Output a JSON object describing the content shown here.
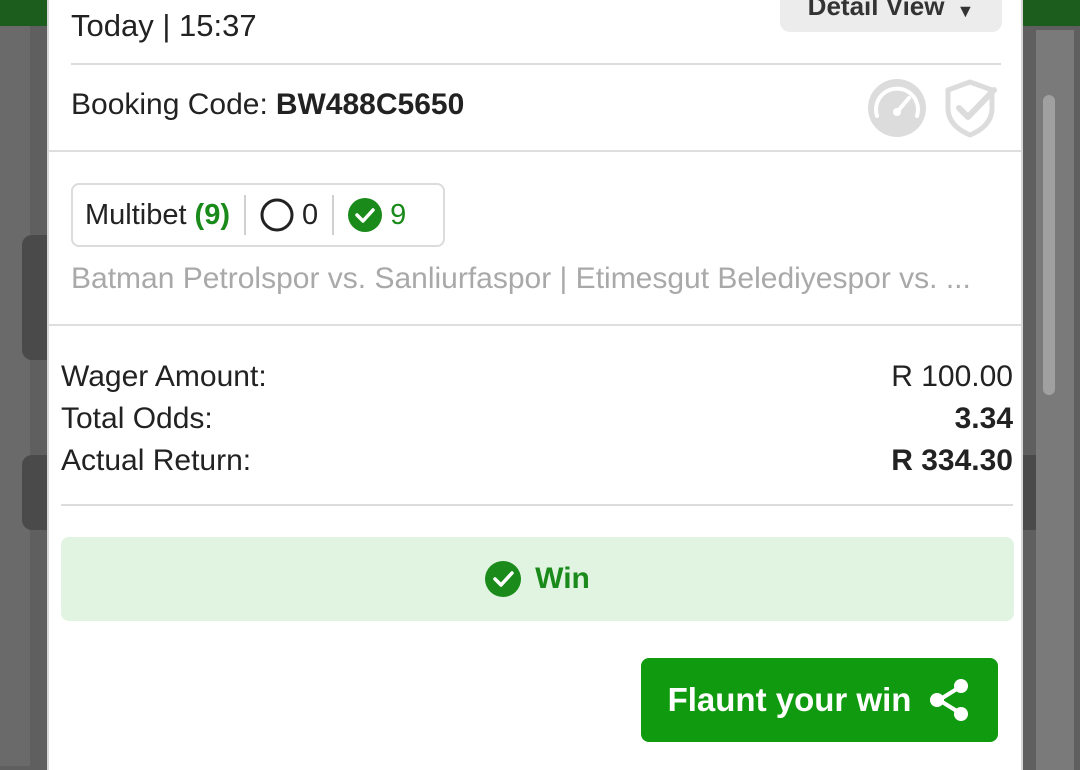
{
  "colors": {
    "accent_green": "#0f9a0f",
    "win_bg": "#e1f3e1",
    "muted_text": "#a9a9a9"
  },
  "header": {
    "date_time": "Today | 15:37",
    "detail_view_label": "Detail View",
    "booking_label": "Booking Code:",
    "booking_code": "BW488C5650"
  },
  "legs": {
    "multibet_label": "Multibet",
    "multibet_count": "(9)",
    "open_count": "0",
    "won_count": "9",
    "matches": "Batman Petrolspor vs. Sanliurfaspor | Etimesgut Belediyespor vs. ..."
  },
  "summary": {
    "wager_label": "Wager Amount:",
    "wager_value": "R 100.00",
    "odds_label": "Total Odds:",
    "odds_value": "3.34",
    "return_label": "Actual Return:",
    "return_value": "R 334.30"
  },
  "result": {
    "status": "Win"
  },
  "actions": {
    "flaunt_label": "Flaunt your win"
  },
  "icons": {
    "gauge": "speedometer-icon",
    "shield": "shield-check-icon",
    "open": "circle-outline-icon",
    "won": "check-circle-icon",
    "share": "share-icon"
  }
}
